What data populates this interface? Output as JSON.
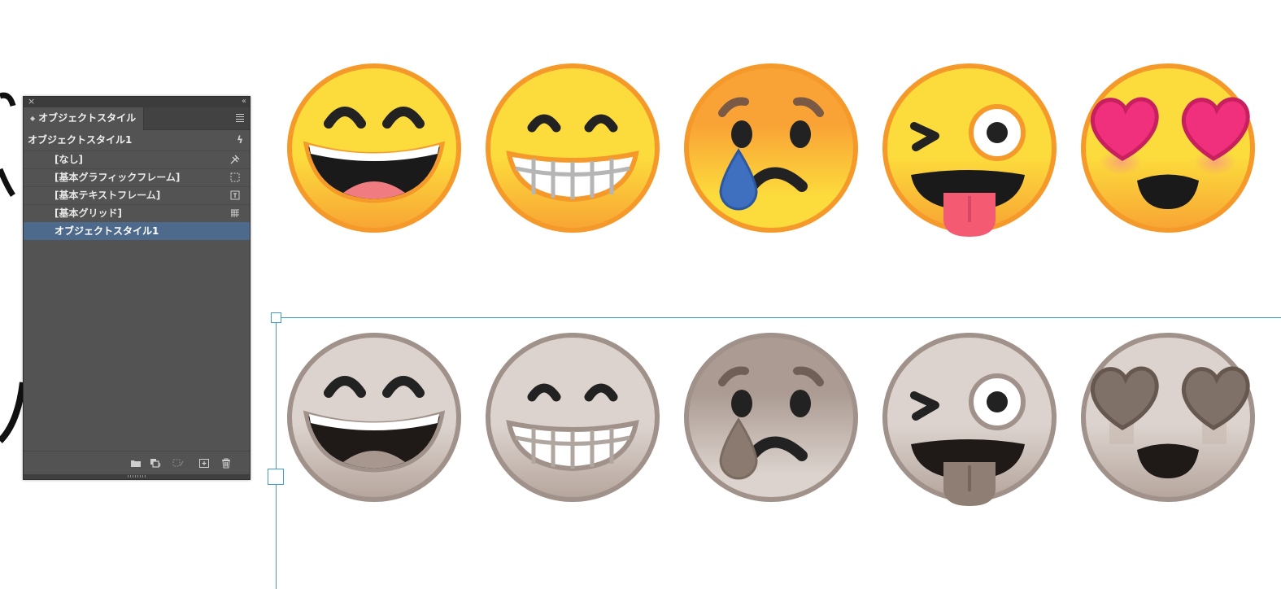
{
  "panel": {
    "close_icon": "×",
    "collapse_icon": "‹‹",
    "tab_label": "オブジェクトスタイル",
    "current_style": "オブジェクトスタイル1",
    "styles": [
      {
        "label": "[なし]",
        "icon": "no-style-icon"
      },
      {
        "label": "[基本グラフィックフレーム]",
        "icon": "graphic-frame-icon"
      },
      {
        "label": "[基本テキストフレーム]",
        "icon": "text-frame-icon"
      },
      {
        "label": "[基本グリッド]",
        "icon": "grid-icon"
      },
      {
        "label": "オブジェクトスタイル1",
        "icon": "",
        "selected": true
      }
    ],
    "bottom_icons": [
      "new-group-folder-icon",
      "clear-overrides-icon",
      "clear-non-defined-attributes-icon",
      "new-style-icon",
      "delete-icon"
    ]
  },
  "canvas": {
    "color_row": [
      "grinning-face-with-smiling-eyes",
      "grinning-face",
      "sad-but-relieved-face",
      "winking-face-with-tongue",
      "smiling-face-with-heart-eyes"
    ],
    "grayscale_row": [
      "grinning-face-with-smiling-eyes",
      "grinning-face",
      "sad-but-relieved-face",
      "winking-face-with-tongue",
      "smiling-face-with-heart-eyes"
    ],
    "accent_color": "#3d9bd6"
  }
}
